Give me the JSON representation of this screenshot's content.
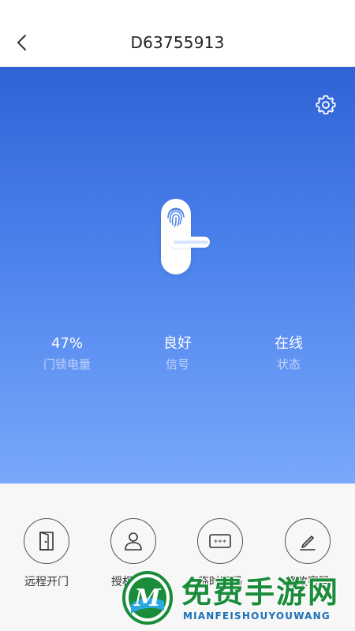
{
  "header": {
    "title": "D63755913",
    "back_icon": "chevron-left-icon"
  },
  "hero": {
    "settings_icon": "gear-icon",
    "lock_icon": "fingerprint-lock-icon",
    "gradient_top": "#2f63d6",
    "gradient_bottom": "#79a8fb"
  },
  "stats": [
    {
      "value": "47%",
      "label": "门锁电量"
    },
    {
      "value": "良好",
      "label": "信号"
    },
    {
      "value": "在线",
      "label": "状态"
    }
  ],
  "battery_level_percent": 47,
  "actions": [
    {
      "label": "远程开门",
      "icon": "door-icon"
    },
    {
      "label": "授权亲用",
      "icon": "user-icon"
    },
    {
      "label": "临时密码",
      "icon": "password-icon"
    },
    {
      "label": "修改密码",
      "icon": "edit-icon"
    }
  ],
  "watermark": {
    "text": "免费手游网",
    "subtext": "MIANFEISHOUYOUWANG",
    "logo_letter": "M",
    "color": "#1a8c3a"
  }
}
